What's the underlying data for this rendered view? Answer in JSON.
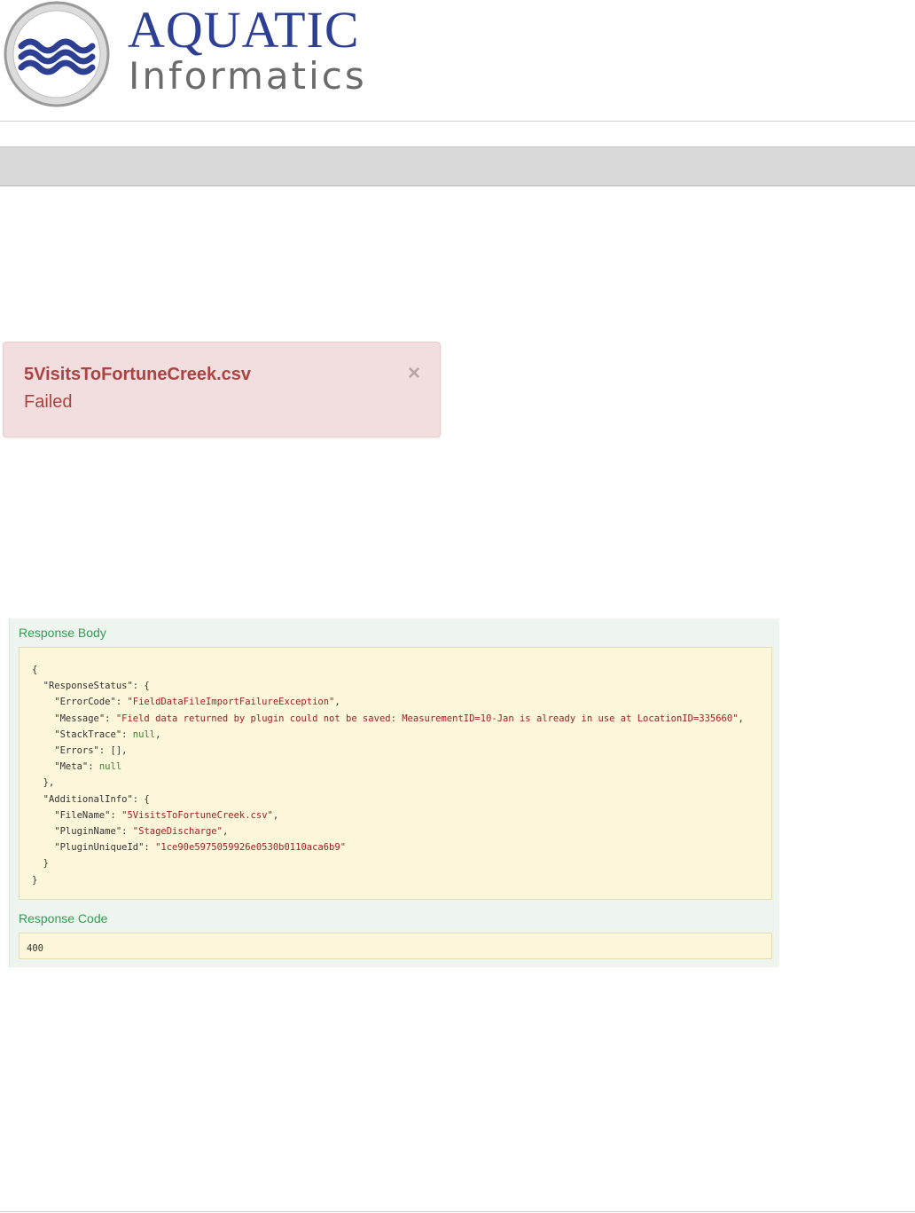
{
  "brand": {
    "name_line1": "AQUATIC",
    "name_line2": "Informatics",
    "colors": {
      "primary": "#2c3f92",
      "secondary": "#6b6b6b"
    }
  },
  "alert": {
    "title": "5VisitsToFortuneCreek.csv",
    "status": "Failed",
    "close_glyph": "×",
    "colors": {
      "background": "#f2dede",
      "text": "#a94442"
    }
  },
  "response": {
    "body_label": "Response Body",
    "code_label": "Response Code",
    "code_value": "400",
    "body_lines": [
      [
        [
          "k",
          "{"
        ]
      ],
      [
        [
          "k",
          "  \"ResponseStatus\": {"
        ]
      ],
      [
        [
          "k",
          "    \"ErrorCode\": "
        ],
        [
          "s",
          "\"FieldDataFileImportFailureException\""
        ],
        [
          "k",
          ","
        ]
      ],
      [
        [
          "k",
          "    \"Message\": "
        ],
        [
          "s",
          "\"Field data returned by plugin could not be saved: MeasurementID=10-Jan is already in use at LocationID=335660\""
        ],
        [
          "k",
          ","
        ]
      ],
      [
        [
          "k",
          "    \"StackTrace\": "
        ],
        [
          "n",
          "null"
        ],
        [
          "k",
          ","
        ]
      ],
      [
        [
          "k",
          "    \"Errors\": [],"
        ]
      ],
      [
        [
          "k",
          "    \"Meta\": "
        ],
        [
          "n",
          "null"
        ]
      ],
      [
        [
          "k",
          "  },"
        ]
      ],
      [
        [
          "k",
          "  \"AdditionalInfo\": {"
        ]
      ],
      [
        [
          "k",
          "    \"FileName\": "
        ],
        [
          "s",
          "\"5VisitsToFortuneCreek.csv\""
        ],
        [
          "k",
          ","
        ]
      ],
      [
        [
          "k",
          "    \"PluginName\": "
        ],
        [
          "s",
          "\"StageDischarge\""
        ],
        [
          "k",
          ","
        ]
      ],
      [
        [
          "k",
          "    \"PluginUniqueId\": "
        ],
        [
          "s",
          "\"1ce90e5975059926e0530b0110aca6b9\""
        ]
      ],
      [
        [
          "k",
          "  }"
        ]
      ],
      [
        [
          "k",
          "}"
        ]
      ]
    ],
    "colors": {
      "label": "#2e9e55",
      "code_bg": "#fcf6db",
      "string": "#a11f1f",
      "null": "#2b8a2b"
    }
  }
}
